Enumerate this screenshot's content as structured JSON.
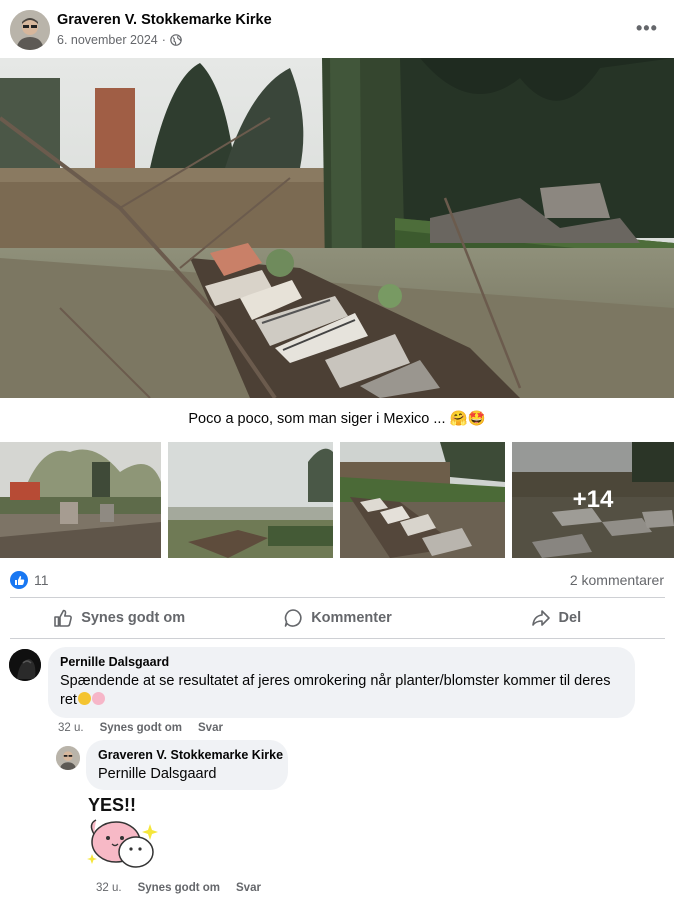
{
  "post": {
    "author": "Graveren V. Stokkemarke Kirke",
    "date": "6. november 2024",
    "separator": "·",
    "privacy_icon": "globe-icon",
    "more_icon": "more-options-icon",
    "caption": "Poco a poco, som man siger i Mexico ... 🤗🤩",
    "more_photos_label": "+14"
  },
  "stats": {
    "reaction_icon": "like-icon",
    "reaction_count": "11",
    "comment_count": "2 kommentarer"
  },
  "actions": {
    "like_label": "Synes godt om",
    "comment_label": "Kommenter",
    "share_label": "Del"
  },
  "comments": [
    {
      "author": "Pernille Dalsgaard",
      "text": "Spændende at se resultatet af jeres omrokering når planter/blomster kommer til deres ret",
      "time": "32 u.",
      "like_label": "Synes godt om",
      "reply_label": "Svar"
    }
  ],
  "reply": {
    "author": "Graveren V. Stokkemarke Kirke",
    "mention": "Pernille Dalsgaard",
    "sticker_text": "YES!!",
    "time": "32 u.",
    "like_label": "Synes godt om",
    "reply_label": "Svar"
  },
  "colors": {
    "accent": "#1877f2",
    "secondary_text": "#65676b",
    "bubble": "#f0f2f5"
  }
}
